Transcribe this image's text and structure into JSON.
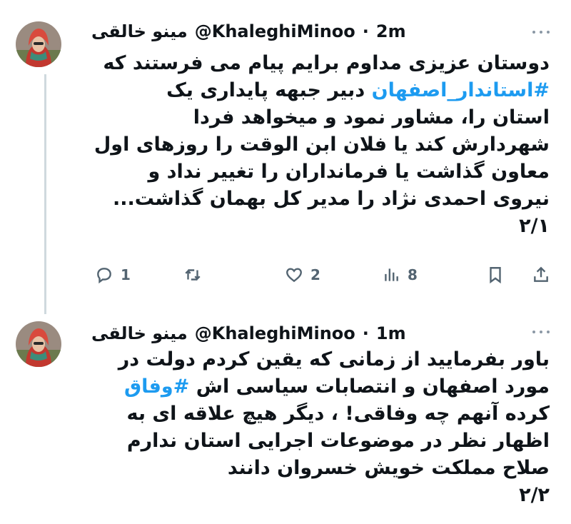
{
  "tweets": [
    {
      "name": "مینو خالقی",
      "handle": "@KhaleghiMinoo",
      "separator": "·",
      "time": "2m",
      "lines": [
        {
          "parts": [
            {
              "text": "دوستان عزیزی مداوم برایم پیام می فرستند که",
              "tag": false
            }
          ]
        },
        {
          "parts": [
            {
              "text": "#استاندار_اصفهان",
              "tag": true
            },
            {
              "text": " دبیر جبهه پایداری یک",
              "tag": false
            }
          ]
        },
        {
          "parts": [
            {
              "text": "استان را، مشاور نمود و میخواهد فردا",
              "tag": false
            }
          ]
        },
        {
          "parts": [
            {
              "text": "شهردارش کند یا فلان ابن الوقت را روزهای اول",
              "tag": false
            }
          ]
        },
        {
          "parts": [
            {
              "text": "معاون گذاشت یا فرمانداران را تغییر نداد و",
              "tag": false
            }
          ]
        },
        {
          "parts": [
            {
              "text": "نیروی احمدی نژاد را مدیر کل بهمان گذاشت...",
              "tag": false
            }
          ]
        },
        {
          "parts": [
            {
              "text": "۲/۱",
              "tag": false
            }
          ]
        }
      ],
      "actions": {
        "reply_count": "1",
        "retweet_count": "",
        "like_count": "2",
        "view_count": "8"
      }
    },
    {
      "name": "مینو خالقی",
      "handle": "@KhaleghiMinoo",
      "separator": "·",
      "time": "1m",
      "lines": [
        {
          "parts": [
            {
              "text": "باور بفرمایید از زمانی که یقین کردم دولت در",
              "tag": false
            }
          ]
        },
        {
          "parts": [
            {
              "text": "مورد اصفهان و انتصابات سیاسی اش ",
              "tag": false
            },
            {
              "text": "#وفاق",
              "tag": true
            }
          ]
        },
        {
          "parts": [
            {
              "text": "کرده آنهم چه وفاقی! ، دیگر هیچ علاقه ای به",
              "tag": false
            }
          ]
        },
        {
          "parts": [
            {
              "text": "اظهار نظر در موضوعات اجرایی استان ندارم",
              "tag": false
            }
          ]
        },
        {
          "parts": [
            {
              "text": "صلاح مملکت خویش خسروان دانند",
              "tag": false
            }
          ]
        },
        {
          "parts": [
            {
              "text": "۲/۲",
              "tag": false
            }
          ]
        }
      ]
    }
  ],
  "icons": {
    "reply": "reply-icon",
    "retweet": "retweet-icon",
    "like": "heart-icon",
    "views": "views-icon",
    "bookmark": "bookmark-icon",
    "share": "share-icon",
    "more": "more-icon"
  },
  "colors": {
    "hashtag": "#1d9bf0",
    "text": "#0f1419",
    "secondary": "#536471",
    "thread_line": "#cfd9de"
  }
}
